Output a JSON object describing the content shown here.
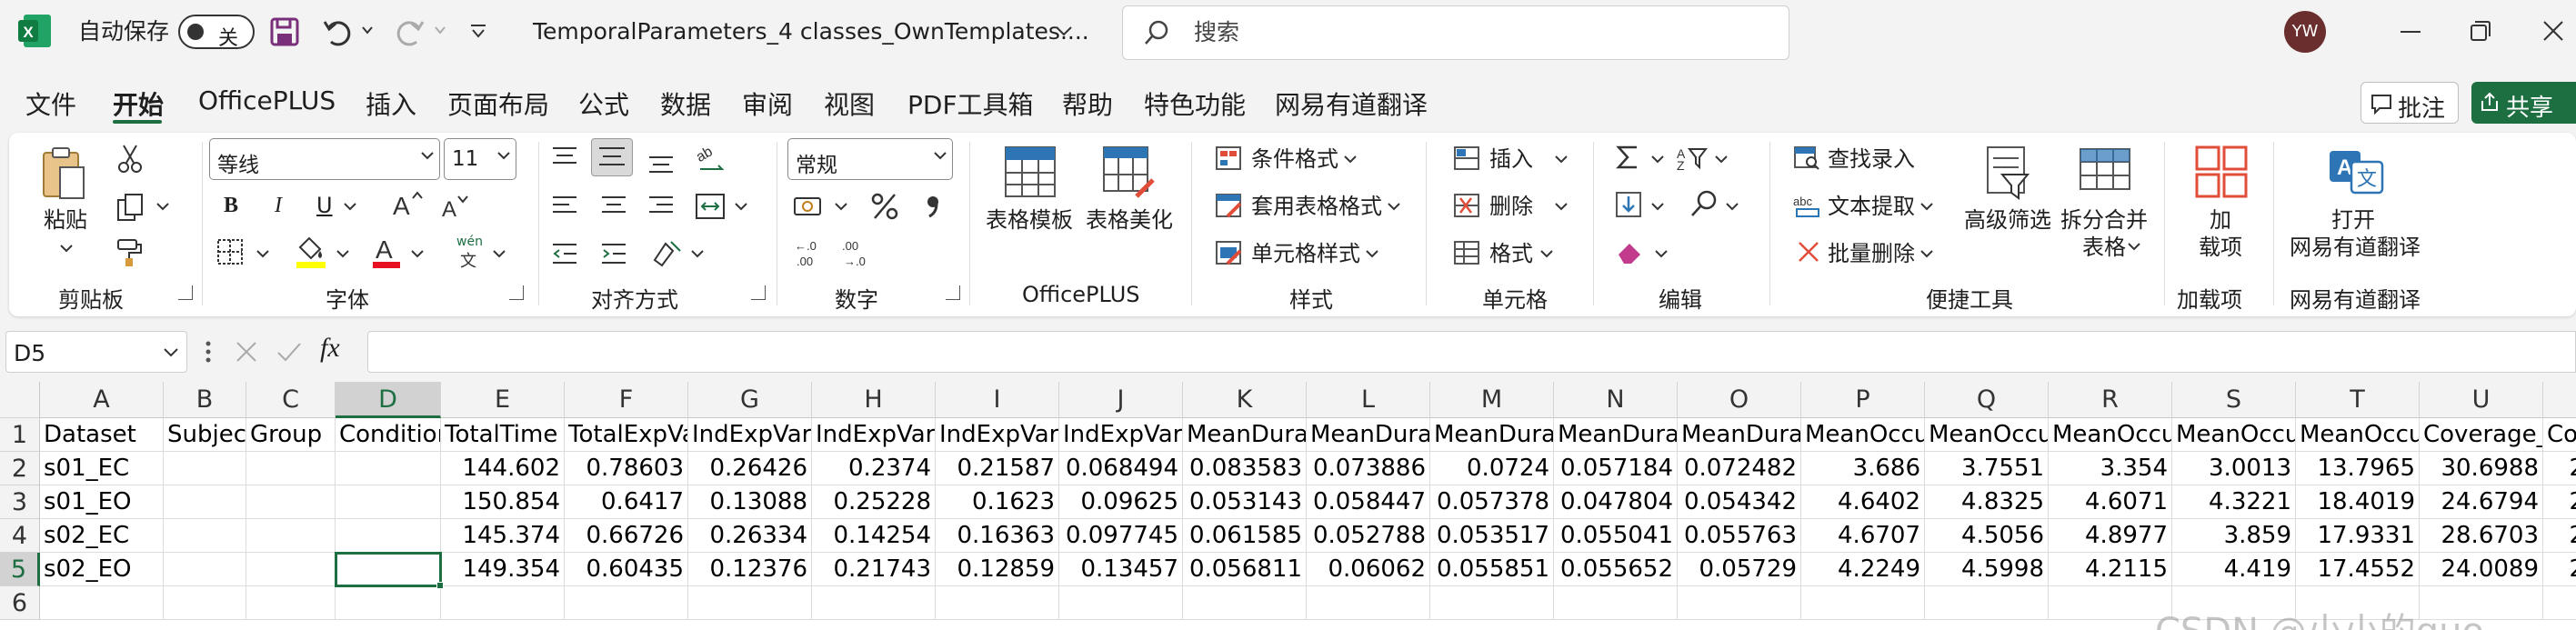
{
  "titlebar": {
    "autosave_label": "自动保存",
    "autosave_state": "关",
    "filename": "TemporalParameters_4 classes_OwnTemplates....",
    "search_placeholder": "搜索",
    "user_initials": "YW"
  },
  "menu": {
    "items": [
      "文件",
      "开始",
      "OfficePLUS",
      "插入",
      "页面布局",
      "公式",
      "数据",
      "审阅",
      "视图",
      "PDF工具箱",
      "帮助",
      "特色功能",
      "网易有道翻译"
    ],
    "active": "开始",
    "comment_label": "批注",
    "share_label": "共享"
  },
  "ribbon": {
    "clipboard": {
      "paste_label": "粘贴",
      "group_label": "剪贴板"
    },
    "font": {
      "font_name": "等线",
      "font_size": "11",
      "group_label": "字体",
      "bold": "B",
      "italic": "I",
      "underline": "U",
      "phonetic": "wén"
    },
    "alignment": {
      "group_label": "对齐方式"
    },
    "number": {
      "format": "常规",
      "group_label": "数字"
    },
    "officeplus": {
      "table_template": "表格模板",
      "table_beautify": "表格美化",
      "group_label": "OfficePLUS"
    },
    "styles": {
      "conditional_format": "条件格式",
      "table_format": "套用表格格式",
      "cell_style": "单元格样式",
      "group_label": "样式"
    },
    "cells": {
      "insert": "插入",
      "delete": "删除",
      "format": "格式",
      "group_label": "单元格"
    },
    "editing": {
      "group_label": "编辑"
    },
    "tools": {
      "find_entry": "查找录入",
      "text_extract": "文本提取",
      "batch_delete": "批量删除",
      "advanced_filter": "高级筛选",
      "split_merge_1": "拆分合并",
      "split_merge_2": "表格",
      "group_label": "便捷工具"
    },
    "addins": {
      "label_1": "加",
      "label_2": "载项",
      "group_label": "加载项"
    },
    "youdao": {
      "label_1": "打开",
      "label_2": "网易有道翻译",
      "group_label": "网易有道翻译"
    }
  },
  "formula_bar": {
    "name_box": "D5",
    "fx": "fx",
    "content": ""
  },
  "sheet": {
    "columns": [
      "A",
      "B",
      "C",
      "D",
      "E",
      "F",
      "G",
      "H",
      "I",
      "J",
      "K",
      "L",
      "M",
      "N",
      "O",
      "P",
      "Q",
      "R",
      "S",
      "T",
      "U"
    ],
    "selected_column": "D",
    "selected_row": "5",
    "rows": [
      {
        "n": "1",
        "cells": [
          "Dataset",
          "Subject",
          "Group",
          "Condition",
          "TotalTime",
          "TotalExpVar",
          "IndExpVar",
          "IndExpVar",
          "IndExpVar",
          "IndExpVar",
          "MeanDura",
          "MeanDura",
          "MeanDura",
          "MeanDura",
          "MeanDura",
          "MeanOccu",
          "MeanOccu",
          "MeanOccu",
          "MeanOccu",
          "MeanOccu",
          "Coverage_",
          "Co"
        ]
      },
      {
        "n": "2",
        "cells": [
          "s01_EC",
          "",
          "",
          "",
          "144.602",
          "0.78603",
          "0.26426",
          "0.2374",
          "0.21587",
          "0.068494",
          "0.083583",
          "0.073886",
          "0.0724",
          "0.057184",
          "0.072482",
          "3.686",
          "3.7551",
          "3.354",
          "3.0013",
          "13.7965",
          "30.6988",
          "2"
        ]
      },
      {
        "n": "3",
        "cells": [
          "s01_EO",
          "",
          "",
          "",
          "150.854",
          "0.6417",
          "0.13088",
          "0.25228",
          "0.1623",
          "0.09625",
          "0.053143",
          "0.058447",
          "0.057378",
          "0.047804",
          "0.054342",
          "4.6402",
          "4.8325",
          "4.6071",
          "4.3221",
          "18.4019",
          "24.6794",
          "2"
        ]
      },
      {
        "n": "4",
        "cells": [
          "s02_EC",
          "",
          "",
          "",
          "145.374",
          "0.66726",
          "0.26334",
          "0.14254",
          "0.16363",
          "0.097745",
          "0.061585",
          "0.052788",
          "0.053517",
          "0.055041",
          "0.055763",
          "4.6707",
          "4.5056",
          "4.8977",
          "3.859",
          "17.9331",
          "28.6703",
          "2"
        ]
      },
      {
        "n": "5",
        "cells": [
          "s02_EO",
          "",
          "",
          "",
          "149.354",
          "0.60435",
          "0.12376",
          "0.21743",
          "0.12859",
          "0.13457",
          "0.056811",
          "0.06062",
          "0.055851",
          "0.055652",
          "0.05729",
          "4.2249",
          "4.5998",
          "4.2115",
          "4.419",
          "17.4552",
          "24.0089",
          "2"
        ]
      },
      {
        "n": "6",
        "cells": [
          "",
          "",
          "",
          "",
          "",
          "",
          "",
          "",
          "",
          "",
          "",
          "",
          "",
          "",
          "",
          "",
          "",
          "",
          "",
          "",
          "",
          ""
        ]
      }
    ]
  },
  "watermark": "CSDN @小小的guo",
  "colors": {
    "excel_green": "#1d6f42",
    "font_red": "#e81123",
    "fill_yellow": "#ffff00"
  }
}
